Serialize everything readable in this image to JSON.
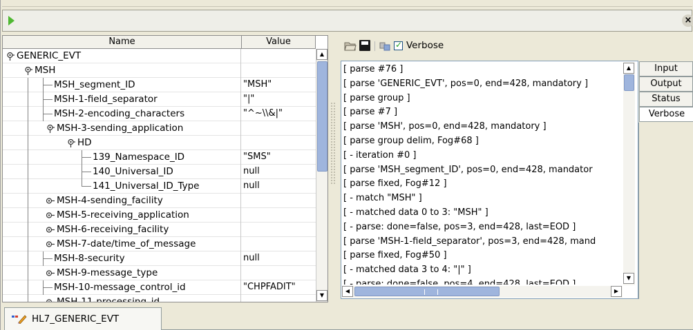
{
  "toolbar": {
    "run_icon": "play-icon",
    "close_icon": "close-icon",
    "close_glyph": "×"
  },
  "tree": {
    "columns": {
      "name": "Name",
      "value": "Value"
    },
    "rows": [
      {
        "label": "GENERIC_EVT",
        "value": "",
        "type": "group"
      },
      {
        "label": "MSH",
        "value": "",
        "type": "group"
      },
      {
        "label": "MSH_segment_ID",
        "value": "\"MSH\"",
        "type": "leaf"
      },
      {
        "label": "MSH-1-field_separator",
        "value": "\"|\"",
        "type": "leaf"
      },
      {
        "label": "MSH-2-encoding_characters",
        "value": "\"^~\\\\&|\"",
        "type": "leaf"
      },
      {
        "label": "MSH-3-sending_application",
        "value": "",
        "type": "group"
      },
      {
        "label": "HD",
        "value": "",
        "type": "group"
      },
      {
        "label": "139_Namespace_ID",
        "value": "\"SMS\"",
        "type": "leaf"
      },
      {
        "label": "140_Universal_ID",
        "value": "null",
        "type": "leaf"
      },
      {
        "label": "141_Universal_ID_Type",
        "value": "null",
        "type": "leaf"
      },
      {
        "label": "MSH-4-sending_facility",
        "value": "",
        "type": "collapsed"
      },
      {
        "label": "MSH-5-receiving_application",
        "value": "",
        "type": "collapsed"
      },
      {
        "label": "MSH-6-receiving_facility",
        "value": "",
        "type": "collapsed"
      },
      {
        "label": "MSH-7-date/time_of_message",
        "value": "",
        "type": "collapsed"
      },
      {
        "label": "MSH-8-security",
        "value": "null",
        "type": "leaf"
      },
      {
        "label": "MSH-9-message_type",
        "value": "",
        "type": "collapsed"
      },
      {
        "label": "MSH-10-message_control_id",
        "value": "\"CHPFADIT\"",
        "type": "leaf"
      },
      {
        "label": "MSH-11-processing_id",
        "value": "",
        "type": "collapsed"
      }
    ]
  },
  "panel": {
    "open_icon": "folder-open-icon",
    "save_icon": "save-icon",
    "find_icon": "find-icon",
    "verbose_label": "Verbose",
    "verbose_checked": true
  },
  "log": {
    "lines": [
      "[ parse #76 ]",
      "[ parse 'GENERIC_EVT', pos=0, end=428, mandatory ]",
      "[ parse group ]",
      "[ parse #7 ]",
      "[ parse 'MSH', pos=0, end=428, mandatory ]",
      "[ parse group delim, Fog#68 ]",
      "[ - iteration #0 ]",
      "[ parse 'MSH_segment_ID', pos=0, end=428, mandator",
      "[ parse fixed, Fog#12 ]",
      "[ - match \"MSH\" ]",
      "[ - matched data 0 to 3: \"MSH\" ]",
      "[ - parse: done=false, pos=3, end=428, last=EOD ]",
      "[ parse 'MSH-1-field_separator', pos=3, end=428, mand",
      "[ parse fixed, Fog#50 ]",
      "[ - matched data 3 to 4: \"|\" ]",
      "[ - parse: done=false, pos=4, end=428, last=EOD ]",
      "[ parse 'MSH-2-encoding_characters', pos=4, end=428"
    ]
  },
  "tabs": [
    "Input",
    "Output",
    "Status",
    "Verbose"
  ],
  "active_tab": "Verbose",
  "bottom_tab": {
    "label": "HL7_GENERIC_EVT",
    "icon": "message-definition-icon"
  }
}
